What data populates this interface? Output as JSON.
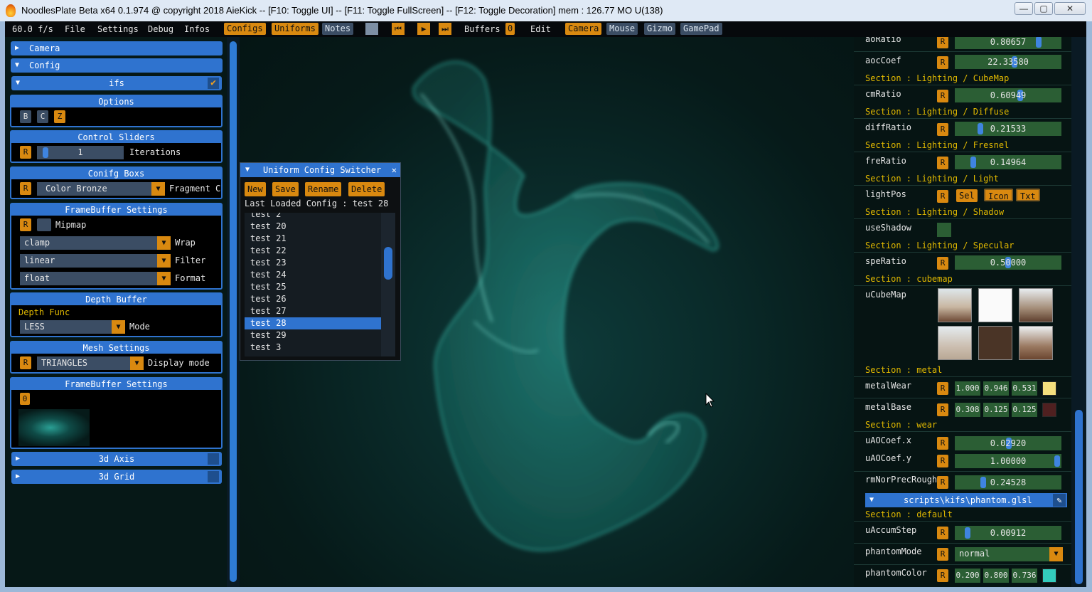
{
  "window": {
    "title": "NoodlesPlate Beta x64 0.1.974 @ copyright 2018 AieKick -- [F10: Toggle UI] -- [F11: Toggle FullScreen] -- [F12: Toggle Decoration] mem : 126.77 MO U(138)",
    "min": "—",
    "max": "▢",
    "close": "✕"
  },
  "menubar": {
    "fps": "60.0 f/s",
    "file": "File",
    "settings": "Settings",
    "debug": "Debug",
    "infos": "Infos",
    "configs": "Configs",
    "uniforms": "Uniforms",
    "notes": "Notes",
    "buffers": "Buffers",
    "buffers_count": "0",
    "edit": "Edit",
    "camera": "Camera",
    "mouse": "Mouse",
    "gizmo": "Gizmo",
    "gamepad": "GamePad",
    "icons": {
      "stop": "stop-icon",
      "first": "skip-back-icon",
      "play": "play-icon",
      "last": "skip-forward-icon"
    }
  },
  "left": {
    "camera": "Camera",
    "config": "Config",
    "ifs": "ifs",
    "options": {
      "title": "Options",
      "b": "B",
      "c": "C",
      "z": "Z"
    },
    "control_sliders": {
      "title": "Control Sliders",
      "r": "R",
      "value": "1",
      "label": "Iterations",
      "fraction": 0.05
    },
    "conifg_boxs": {
      "title": "Conifg Boxs",
      "r": "R",
      "value": "Color Bronze",
      "label": "Fragment Co"
    },
    "fb_settings": {
      "title": "FrameBuffer Settings",
      "r": "R",
      "mipmap": "Mipmap",
      "wrap_value": "clamp",
      "wrap": "Wrap",
      "filter_value": "linear",
      "filter": "Filter",
      "format_value": "float",
      "format": "Format"
    },
    "depth_buffer": {
      "title": "Depth Buffer",
      "func": "Depth Func",
      "value": "LESS",
      "mode": "Mode"
    },
    "mesh_settings": {
      "title": "Mesh Settings",
      "r": "R",
      "value": "TRIANGLES",
      "label": "Display mode"
    },
    "fb_settings2": {
      "title": "FrameBuffer Settings",
      "idx": "0"
    },
    "axis": "3d Axis",
    "grid": "3d Grid"
  },
  "switcher": {
    "title": "Uniform Config Switcher",
    "new": "New",
    "save": "Save",
    "rename": "Rename",
    "delete": "Delete",
    "last_loaded": "Last Loaded Config : test 28",
    "items": [
      "test 2",
      "test 20",
      "test 21",
      "test 22",
      "test 23",
      "test 24",
      "test 25",
      "test 26",
      "test 27",
      "test 28",
      "test 29",
      "test 3"
    ],
    "selected": "test 28"
  },
  "right": {
    "aoRatio": {
      "name": "aoRatio",
      "r": "R",
      "value": "0.80657"
    },
    "aocCoef": {
      "name": "aocCoef",
      "r": "R",
      "value": "22.33580"
    },
    "sec_cubemap": "Section : Lighting / CubeMap",
    "cmRatio": {
      "name": "cmRatio",
      "r": "R",
      "value": "0.60949"
    },
    "sec_diffuse": "Section : Lighting / Diffuse",
    "diffRatio": {
      "name": "diffRatio",
      "r": "R",
      "value": "0.21533"
    },
    "sec_fresnel": "Section : Lighting / Fresnel",
    "freRatio": {
      "name": "freRatio",
      "r": "R",
      "value": "0.14964"
    },
    "sec_light": "Section : Lighting / Light",
    "lightPos": {
      "name": "lightPos",
      "r": "R",
      "sel": "Sel",
      "icon": "Icon",
      "txt": "Txt"
    },
    "sec_shadow": "Section : Lighting / Shadow",
    "useShadow": {
      "name": "useShadow"
    },
    "sec_specular": "Section : Lighting / Specular",
    "speRatio": {
      "name": "speRatio",
      "r": "R",
      "value": "0.50000"
    },
    "sec_cubemap2": "Section : cubemap",
    "uCubeMap": {
      "name": "uCubeMap"
    },
    "sec_metal": "Section : metal",
    "metalWear": {
      "name": "metalWear",
      "r": "R",
      "v1": "1.000",
      "v2": "0.946",
      "v3": "0.531",
      "color": "#f4df7d"
    },
    "metalBase": {
      "name": "metalBase",
      "r": "R",
      "v1": "0.308",
      "v2": "0.125",
      "v3": "0.125",
      "color": "#4f2020"
    },
    "sec_wear": "Section : wear",
    "uAOCoefx": {
      "name": "uAOCoef.x",
      "r": "R",
      "value": "0.02920"
    },
    "uAOCoefy": {
      "name": "uAOCoef.y",
      "r": "R",
      "value": "1.00000"
    },
    "rmNorPrecRough": {
      "name": "rmNorPrecRough",
      "r": "R",
      "value": "0.24528"
    },
    "script": "scripts\\kifs\\phantom.glsl",
    "sec_default": "Section : default",
    "uAccumStep": {
      "name": "uAccumStep",
      "r": "R",
      "value": "0.00912"
    },
    "phantomMode": {
      "name": "phantomMode",
      "r": "R",
      "value": "normal"
    },
    "phantomColor": {
      "name": "phantomColor",
      "r": "R",
      "v1": "0.200",
      "v2": "0.800",
      "v3": "0.736",
      "color": "#33ccbc"
    }
  }
}
